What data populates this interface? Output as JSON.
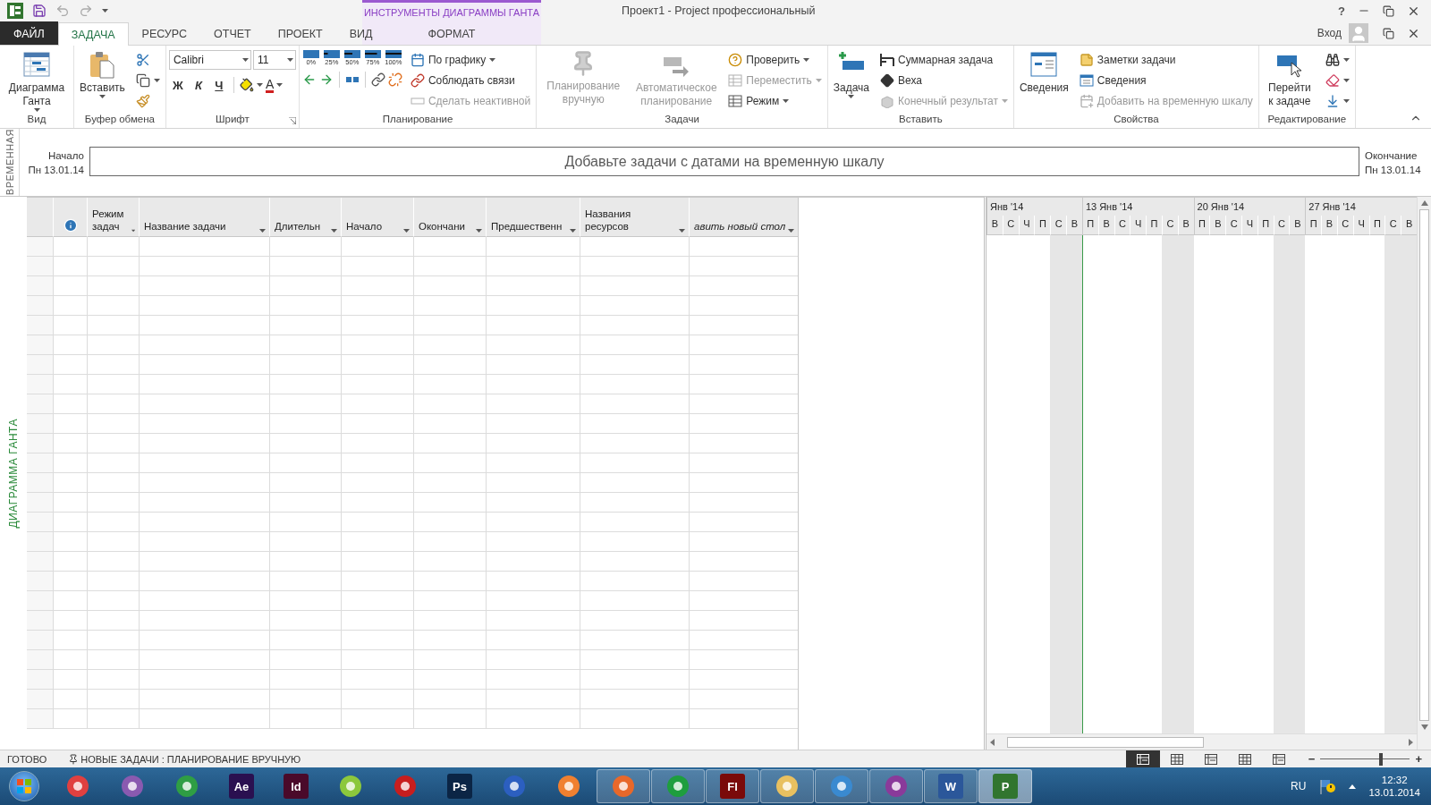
{
  "title_bar": {
    "title": "Проект1 - Project профессиональный",
    "help": "?"
  },
  "contextual": {
    "label": "ИНСТРУМЕНТЫ ДИАГРАММЫ ГАНТА",
    "tab": {
      "label": "ФОРМАТ",
      "selected": false
    }
  },
  "tabs": [
    {
      "label": "ФАЙЛ",
      "kind": "file",
      "selected": false
    },
    {
      "label": "ЗАДАЧА",
      "kind": "tab",
      "selected": true
    },
    {
      "label": "РЕСУРС",
      "kind": "tab",
      "selected": false
    },
    {
      "label": "ОТЧЕТ",
      "kind": "tab",
      "selected": false
    },
    {
      "label": "ПРОЕКТ",
      "kind": "tab",
      "selected": false
    },
    {
      "label": "ВИД",
      "kind": "tab",
      "selected": false
    }
  ],
  "account": {
    "label": "Вход"
  },
  "ribbon": {
    "groups": [
      {
        "label": "Вид",
        "launcher": false,
        "columns": [
          {
            "kind": "large",
            "label": "Диаграмма Ганта",
            "dropdown": true,
            "disabled": false
          }
        ]
      },
      {
        "label": "Буфер обмена",
        "launcher": false,
        "columns": [
          {
            "kind": "large",
            "label": "Вставить",
            "dropdown": true,
            "disabled": false
          },
          {
            "kind": "icons",
            "items": [
              {
                "dropdown": false,
                "disabled": false
              },
              {
                "dropdown": true,
                "disabled": false
              },
              {
                "dropdown": false,
                "disabled": false
              }
            ]
          }
        ]
      },
      {
        "label": "Шрифт",
        "launcher": true,
        "columns": [
          {
            "kind": "font",
            "font": "Calibri",
            "size": "11",
            "bold": "Ж",
            "italic": "К",
            "underline": "Ч",
            "color_letter": "А"
          }
        ]
      },
      {
        "label": "Планирование",
        "launcher": false,
        "columns": [
          {
            "kind": "percent",
            "labels": [
              "0%",
              "25%",
              "50%",
              "75%",
              "100%"
            ]
          },
          {
            "kind": "stack",
            "items": [
              {
                "label": "По графику",
                "dropdown": true,
                "disabled": false
              },
              {
                "label": "Соблюдать связи",
                "dropdown": false,
                "disabled": false
              },
              {
                "label": "Сделать неактивной",
                "dropdown": false,
                "disabled": true
              }
            ]
          }
        ]
      },
      {
        "label": "Задачи",
        "launcher": false,
        "columns": [
          {
            "kind": "large",
            "label": "Планирование вручную",
            "dropdown": false,
            "disabled": true
          },
          {
            "kind": "large",
            "label": "Автоматическое планирование",
            "dropdown": false,
            "disabled": true
          },
          {
            "kind": "stack",
            "items": [
              {
                "label": "Проверить",
                "dropdown": true,
                "disabled": false
              },
              {
                "label": "Переместить",
                "dropdown": true,
                "disabled": true
              },
              {
                "label": "Режим",
                "dropdown": true,
                "disabled": false
              }
            ]
          }
        ]
      },
      {
        "label": "Вставить",
        "launcher": false,
        "columns": [
          {
            "kind": "large",
            "label": "Задача",
            "dropdown": true,
            "disabled": false
          },
          {
            "kind": "stack",
            "items": [
              {
                "label": "Суммарная задача",
                "dropdown": false,
                "disabled": false
              },
              {
                "label": "Веха",
                "dropdown": false,
                "disabled": false
              },
              {
                "label": "Конечный результат",
                "dropdown": true,
                "disabled": true
              }
            ]
          }
        ]
      },
      {
        "label": "Свойства",
        "launcher": false,
        "columns": [
          {
            "kind": "large",
            "label": "Сведения",
            "dropdown": false,
            "disabled": false
          },
          {
            "kind": "stack",
            "items": [
              {
                "label": "Заметки задачи",
                "dropdown": false,
                "disabled": false
              },
              {
                "label": "Сведения",
                "dropdown": false,
                "disabled": false
              },
              {
                "label": "Добавить на временную шкалу",
                "dropdown": false,
                "disabled": true
              }
            ]
          }
        ]
      },
      {
        "label": "Редактирование",
        "launcher": false,
        "columns": [
          {
            "kind": "large",
            "label": "Перейти к задаче",
            "dropdown": false,
            "disabled": false
          },
          {
            "kind": "icons",
            "items": [
              {
                "dropdown": true,
                "disabled": false
              },
              {
                "dropdown": true,
                "disabled": false
              },
              {
                "dropdown": true,
                "disabled": false
              }
            ]
          }
        ]
      }
    ]
  },
  "timeline": {
    "side_label": "ВРЕМЕННАЯ",
    "start_label": "Начало",
    "start_date": "Пн 13.01.14",
    "placeholder": "Добавьте задачи с датами на временную шкалу",
    "end_label": "Окончание",
    "end_date": "Пн 13.01.14"
  },
  "view_label": "ДИАГРАММА ГАНТА",
  "table": {
    "columns": [
      {
        "kind": "info"
      },
      {
        "kind": "text",
        "label": "Режим задач",
        "italic": false
      },
      {
        "kind": "text",
        "label": "Название задачи",
        "italic": false
      },
      {
        "kind": "text",
        "label": "Длительн",
        "italic": false
      },
      {
        "kind": "text",
        "label": "Начало",
        "italic": false
      },
      {
        "kind": "text",
        "label": "Окончани",
        "italic": false
      },
      {
        "kind": "text",
        "label": "Предшественн",
        "italic": false
      },
      {
        "kind": "text",
        "label": "Названия ресурсов",
        "italic": false
      },
      {
        "kind": "text",
        "label": "авить новый стол",
        "italic": true
      }
    ]
  },
  "gantt": {
    "weeks": [
      {
        "label": "Янв '14",
        "days": [
          {
            "label": "В",
            "weekend": false,
            "today": false
          },
          {
            "label": "С",
            "weekend": false,
            "today": false
          },
          {
            "label": "Ч",
            "weekend": false,
            "today": false
          },
          {
            "label": "П",
            "weekend": false,
            "today": false
          },
          {
            "label": "С",
            "weekend": true,
            "today": false
          },
          {
            "label": "В",
            "weekend": true,
            "today": false
          }
        ]
      },
      {
        "label": "13 Янв '14",
        "days": [
          {
            "label": "П",
            "weekend": false,
            "today": true
          },
          {
            "label": "В",
            "weekend": false,
            "today": false
          },
          {
            "label": "С",
            "weekend": false,
            "today": false
          },
          {
            "label": "Ч",
            "weekend": false,
            "today": false
          },
          {
            "label": "П",
            "weekend": false,
            "today": false
          },
          {
            "label": "С",
            "weekend": true,
            "today": false
          },
          {
            "label": "В",
            "weekend": true,
            "today": false
          }
        ]
      },
      {
        "label": "20 Янв '14",
        "days": [
          {
            "label": "П",
            "weekend": false,
            "today": false
          },
          {
            "label": "В",
            "weekend": false,
            "today": false
          },
          {
            "label": "С",
            "weekend": false,
            "today": false
          },
          {
            "label": "Ч",
            "weekend": false,
            "today": false
          },
          {
            "label": "П",
            "weekend": false,
            "today": false
          },
          {
            "label": "С",
            "weekend": true,
            "today": false
          },
          {
            "label": "В",
            "weekend": true,
            "today": false
          }
        ]
      },
      {
        "label": "27 Янв '14",
        "days": [
          {
            "label": "П",
            "weekend": false,
            "today": false
          },
          {
            "label": "В",
            "weekend": false,
            "today": false
          },
          {
            "label": "С",
            "weekend": false,
            "today": false
          },
          {
            "label": "Ч",
            "weekend": false,
            "today": false
          },
          {
            "label": "П",
            "weekend": false,
            "today": false
          },
          {
            "label": "С",
            "weekend": true,
            "today": false
          },
          {
            "label": "В",
            "weekend": true,
            "today": false
          }
        ]
      }
    ]
  },
  "status_bar": {
    "ready": "ГОТОВО",
    "new_tasks": "НОВЫЕ ЗАДАЧИ : ПЛАНИРОВАНИЕ ВРУЧНУЮ",
    "views": [
      {
        "selected": true
      },
      {
        "selected": false
      },
      {
        "selected": false
      },
      {
        "selected": false
      },
      {
        "selected": false
      }
    ],
    "zoom": {
      "minus": "−",
      "plus": "+",
      "level": 0.68
    }
  },
  "taskbar": {
    "items": [
      {
        "kind": "symbol",
        "color": "#e04040",
        "running": false,
        "selected": false
      },
      {
        "kind": "symbol",
        "color": "#8a5ab0",
        "running": false,
        "selected": false
      },
      {
        "kind": "symbol",
        "color": "#2f9e44",
        "running": false,
        "selected": false
      },
      {
        "kind": "letter",
        "glyph": "Ae",
        "color": "#2a1050",
        "running": false,
        "selected": false
      },
      {
        "kind": "letter",
        "glyph": "Id",
        "color": "#4a0a2a",
        "running": false,
        "selected": false
      },
      {
        "kind": "symbol",
        "color": "#8cc83c",
        "running": false,
        "selected": false
      },
      {
        "kind": "symbol",
        "color": "#c81e1e",
        "running": false,
        "selected": false
      },
      {
        "kind": "letter",
        "glyph": "Ps",
        "color": "#0b2545",
        "running": false,
        "selected": false
      },
      {
        "kind": "symbol",
        "color": "#2c5fc0",
        "running": false,
        "selected": false
      },
      {
        "kind": "symbol",
        "color": "#f08030",
        "running": false,
        "selected": false
      },
      {
        "kind": "symbol",
        "color": "#e8682a",
        "running": true,
        "selected": false
      },
      {
        "kind": "symbol",
        "color": "#1e9e3e",
        "running": true,
        "selected": false
      },
      {
        "kind": "letter",
        "glyph": "Fl",
        "color": "#7a0a0a",
        "running": true,
        "selected": false
      },
      {
        "kind": "symbol",
        "color": "#e8c060",
        "running": true,
        "selected": false
      },
      {
        "kind": "symbol",
        "color": "#3a8ad0",
        "running": true,
        "selected": false
      },
      {
        "kind": "symbol",
        "color": "#8a3a9a",
        "running": true,
        "selected": false
      },
      {
        "kind": "letter",
        "glyph": "W",
        "color": "#2b579a",
        "running": true,
        "selected": false
      },
      {
        "kind": "letter",
        "glyph": "P",
        "color": "#31752f",
        "running": true,
        "selected": true
      }
    ],
    "language": "RU",
    "time": "12:32",
    "date": "13.01.2014"
  }
}
